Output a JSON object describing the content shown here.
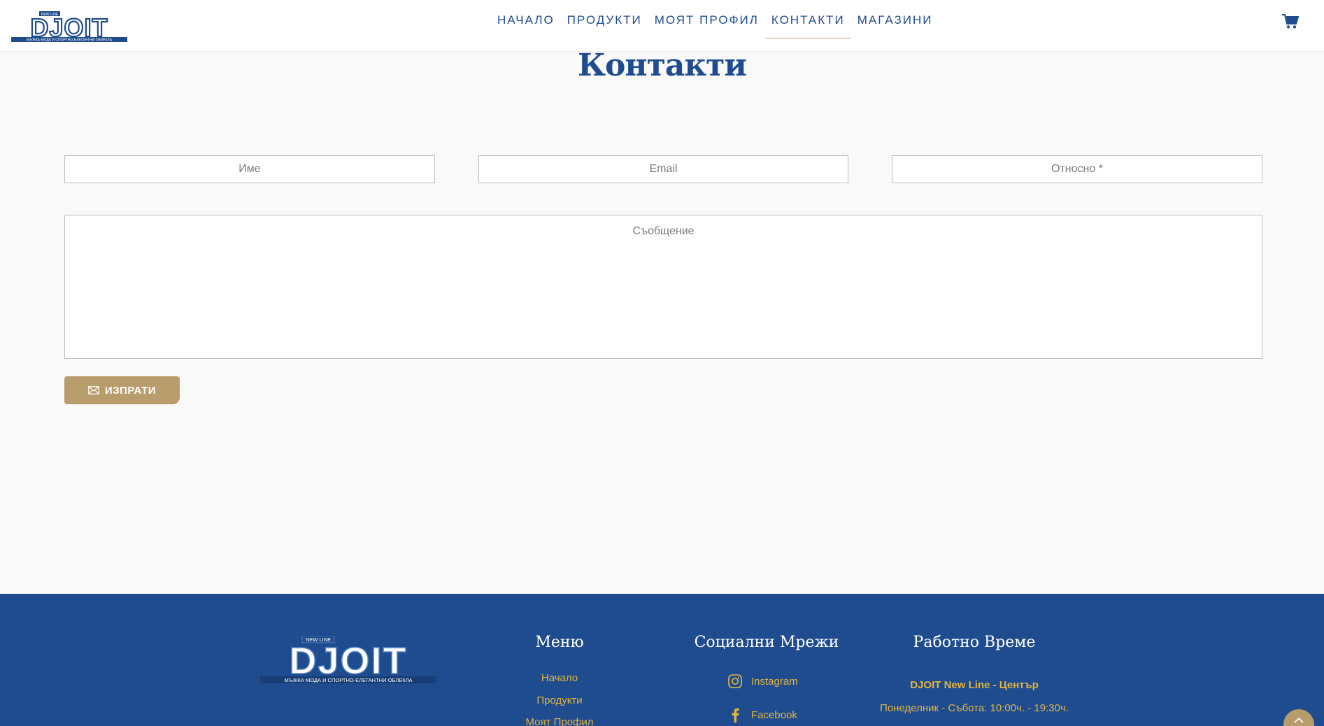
{
  "header": {
    "logo": {
      "brand": "DJOIT",
      "tagline_top": "NEW LINE",
      "tagline_bottom": "МЪЖКА МОДА И СПОРТНО-ЕЛЕГАНТНИ ОБЛЕКЛА"
    },
    "nav": [
      {
        "label": "НАЧАЛО",
        "active": false
      },
      {
        "label": "ПРОДУКТИ",
        "active": false
      },
      {
        "label": "МОЯТ ПРОФИЛ",
        "active": false
      },
      {
        "label": "КОНТАКТИ",
        "active": true
      },
      {
        "label": "МАГАЗИНИ",
        "active": false
      }
    ],
    "cart_icon": "shopping-cart-icon"
  },
  "main": {
    "title": "Контакти",
    "form": {
      "name_placeholder": "Име",
      "email_placeholder": "Email",
      "subject_placeholder": "Относно *",
      "message_placeholder": "Съобщение",
      "send_label": "ИЗПРАТИ",
      "send_icon": "envelope-icon"
    }
  },
  "footer": {
    "logo": {
      "brand": "DJOIT",
      "tagline_top": "NEW LINE",
      "tagline_bottom": "МЪЖКА МОДА И СПОРТНО-ЕЛЕГАНТНИ ОБЛЕКЛА"
    },
    "menu": {
      "title": "Меню",
      "items": [
        "Начало",
        "Продукти",
        "Моят Профил"
      ]
    },
    "social": {
      "title": "Социални Мрежи",
      "items": [
        {
          "label": "Instagram",
          "icon": "instagram-icon"
        },
        {
          "label": "Facebook",
          "icon": "facebook-icon"
        }
      ]
    },
    "hours": {
      "title": "Работно Време",
      "store": "DJOIT New Line - Център",
      "schedule": "Понеделник - Събота: 10:00ч. - 19:30ч."
    }
  },
  "colors": {
    "primary": "#1f4c8f",
    "accent": "#b99c6b",
    "footer_link": "#e4b53f",
    "background": "#f9f9f9"
  }
}
